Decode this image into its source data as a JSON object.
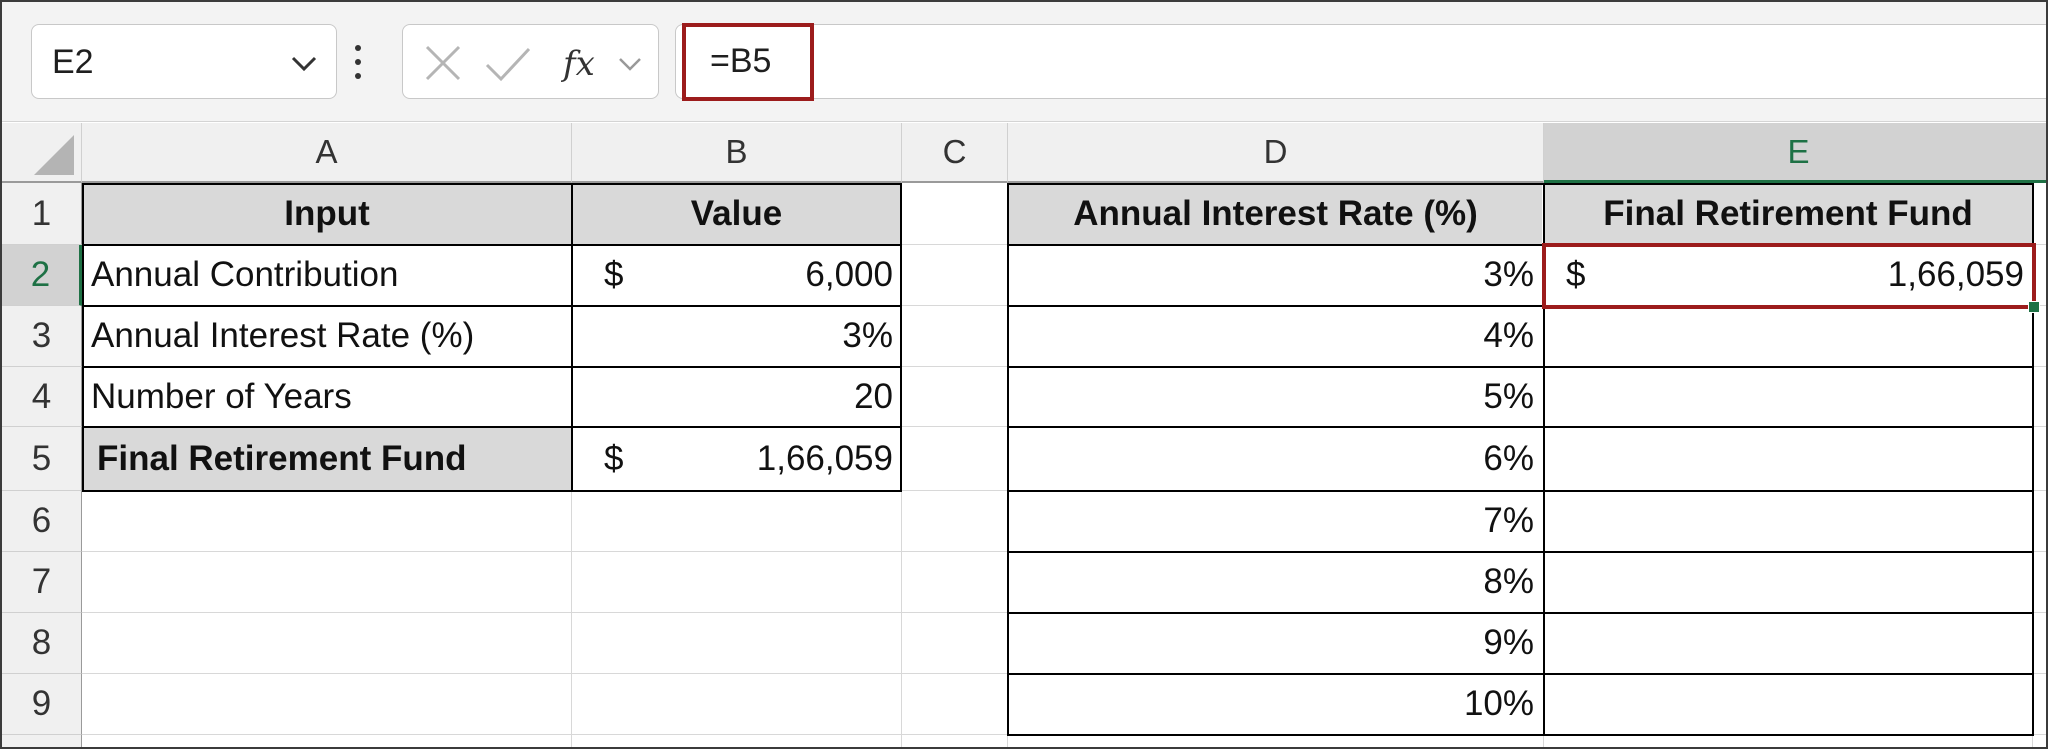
{
  "formula_bar": {
    "name_box": "E2",
    "formula": "=B5",
    "icons": [
      "chevron-down-icon",
      "vertical-dots-icon",
      "cancel-x-icon",
      "enter-check-icon",
      "fx-icon",
      "chevron-down-icon"
    ]
  },
  "columns": [
    "A",
    "B",
    "C",
    "D",
    "E"
  ],
  "rows": [
    "1",
    "2",
    "3",
    "4",
    "5",
    "6",
    "7",
    "8",
    "9"
  ],
  "input_table": {
    "header_input": "Input",
    "header_value": "Value",
    "rows": [
      {
        "label": "Annual Contribution",
        "currency": "$",
        "value": "6,000"
      },
      {
        "label": "Annual Interest Rate (%)",
        "currency": "",
        "value": "3%"
      },
      {
        "label": "Number of Years",
        "currency": "",
        "value": "20"
      },
      {
        "label": "Final Retirement Fund",
        "currency": "$",
        "value": "1,66,059"
      }
    ]
  },
  "sensitivity_table": {
    "header_rate": "Annual Interest Rate (%)",
    "header_fund": "Final Retirement Fund",
    "fund_currency": "$",
    "fund_value": "1,66,059",
    "rates": [
      "3%",
      "4%",
      "5%",
      "6%",
      "7%",
      "8%",
      "9%",
      "10%"
    ]
  },
  "colors": {
    "highlight": "#9c1c1c",
    "selection": "#1e7145",
    "header_fill": "#d9d9d9"
  }
}
